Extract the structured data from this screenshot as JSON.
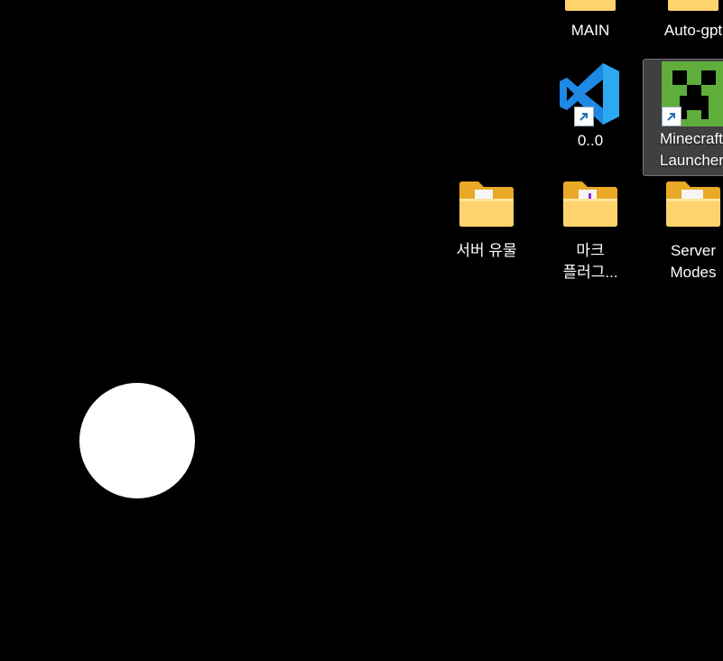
{
  "desktop": {
    "icons": [
      {
        "name": "main-folder",
        "label": "MAIN",
        "type": "folder"
      },
      {
        "name": "auto-gpt-folder",
        "label": "Auto-gpt",
        "type": "folder"
      },
      {
        "name": "vscode-shortcut",
        "label": "0..0",
        "type": "shortcut",
        "icon": "vscode-icon"
      },
      {
        "name": "minecraft-launcher-shortcut",
        "label": "Minecraft\nLauncher",
        "type": "shortcut",
        "icon": "minecraft-creeper-icon",
        "selected": true
      },
      {
        "name": "server-relics-folder",
        "label": "서버 유물",
        "type": "folder"
      },
      {
        "name": "mark-plugins-folder",
        "label": "마크\n플러그...",
        "type": "folder"
      },
      {
        "name": "server-modes-folder",
        "label": "Server\nModes",
        "type": "folder"
      }
    ]
  },
  "overlay": {
    "circle_color": "#ffffff"
  },
  "colors": {
    "background": "#000000",
    "folder": "#ffc83d",
    "vscode_blue": "#1e88e5",
    "creeper_green": "#5fae3c"
  }
}
